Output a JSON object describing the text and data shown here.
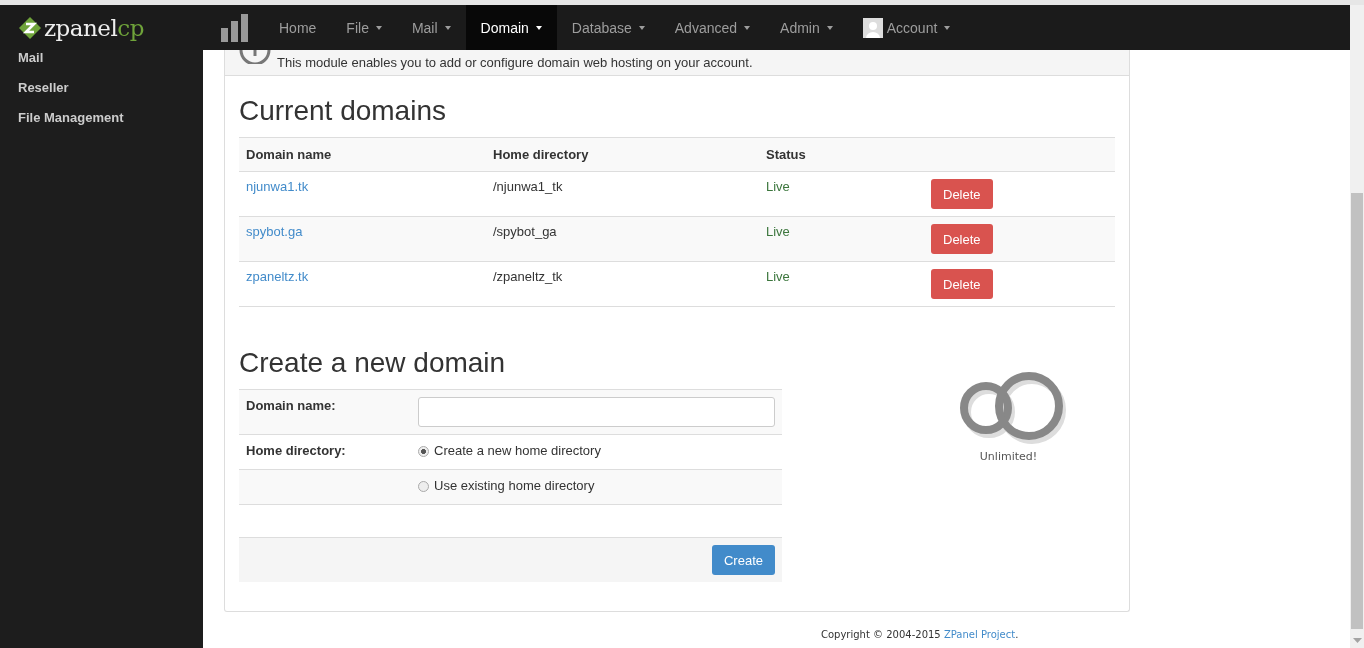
{
  "brand": {
    "name": "zpanel",
    "suffix": "cp"
  },
  "nav": [
    {
      "label": "Home",
      "dropdown": false,
      "selected": false,
      "kind": "link"
    },
    {
      "label": "File",
      "dropdown": true,
      "selected": false,
      "kind": "link"
    },
    {
      "label": "Mail",
      "dropdown": true,
      "selected": false,
      "kind": "link"
    },
    {
      "label": "Domain",
      "dropdown": true,
      "selected": true,
      "kind": "link"
    },
    {
      "label": "Database",
      "dropdown": true,
      "selected": false,
      "kind": "link"
    },
    {
      "label": "Advanced",
      "dropdown": true,
      "selected": false,
      "kind": "link"
    },
    {
      "label": "Admin",
      "dropdown": true,
      "selected": false,
      "kind": "link"
    },
    {
      "label": "Account",
      "dropdown": true,
      "selected": false,
      "kind": "account"
    }
  ],
  "sidebar": {
    "items": [
      "Mail",
      "Reseller",
      "File Management"
    ]
  },
  "info": "This module enables you to add or configure domain web hosting on your account.",
  "current": {
    "title": "Current domains",
    "columns": [
      "Domain name",
      "Home directory",
      "Status"
    ],
    "rows": [
      {
        "domain": "njunwa1.tk",
        "directory": "/njunwa1_tk",
        "status": "Live",
        "action": "Delete"
      },
      {
        "domain": "spybot.ga",
        "directory": "/spybot_ga",
        "status": "Live",
        "action": "Delete"
      },
      {
        "domain": "zpaneltz.tk",
        "directory": "/zpaneltz_tk",
        "status": "Live",
        "action": "Delete"
      }
    ]
  },
  "create": {
    "title": "Create a new domain",
    "domain_label": "Domain name:",
    "directory_label": "Home directory:",
    "options": [
      {
        "label": "Create a new home directory",
        "selected": true
      },
      {
        "label": "Use existing home directory",
        "selected": false
      }
    ],
    "button": "Create"
  },
  "quota": {
    "label": "Unlimited!"
  },
  "footer": {
    "text": "Copyright © 2004-2015 ",
    "link": "ZPanel Project",
    "end": "."
  }
}
